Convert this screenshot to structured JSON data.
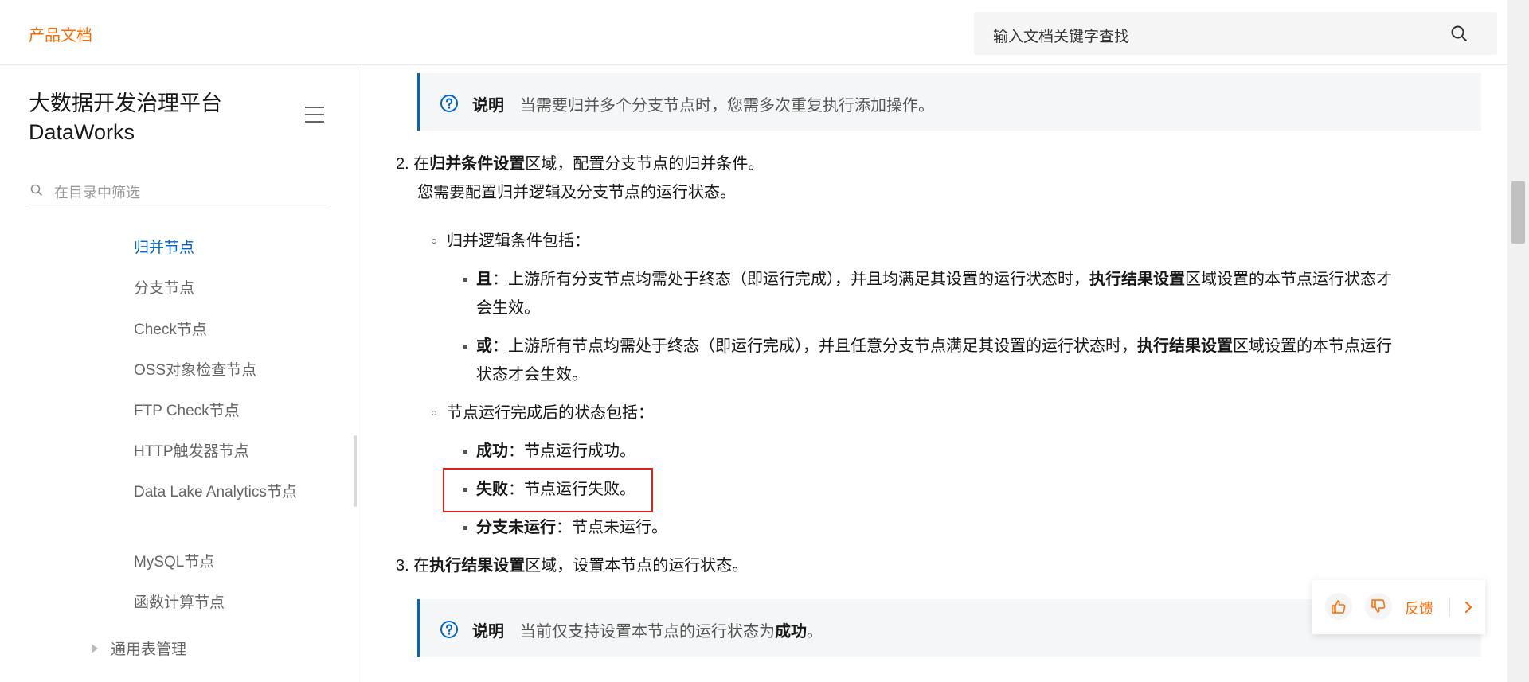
{
  "header": {
    "brand": "产品文档",
    "search_placeholder": "输入文档关键字查找"
  },
  "sidebar": {
    "title_line1": "大数据开发治理平台",
    "title_line2": "DataWorks",
    "filter_placeholder": "在目录中筛选",
    "items": [
      {
        "label": "归并节点",
        "active": true
      },
      {
        "label": "分支节点"
      },
      {
        "label": "Check节点"
      },
      {
        "label": "OSS对象检查节点"
      },
      {
        "label": "FTP Check节点"
      },
      {
        "label": "HTTP触发器节点"
      },
      {
        "label": "Data Lake Analytics节点"
      },
      {
        "label": "MySQL节点"
      },
      {
        "label": "函数计算节点"
      }
    ],
    "group": "通用表管理"
  },
  "content": {
    "note1": {
      "label": "说明",
      "text": "当需要归并多个分支节点时，您需多次重复执行添加操作。"
    },
    "step2": {
      "num": "2.",
      "pre": "在",
      "bold": "归并条件设置",
      "post": "区域，配置分支节点的归并条件。",
      "sub": "您需要配置归并逻辑及分支节点的运行状态。"
    },
    "logic_intro": "归并逻辑条件包括：",
    "and_item": {
      "bold": "且",
      "text1": "：上游所有分支节点均需处于终态（即运行完成），并且均满足其设置的运行状态时，",
      "bold2": "执行结果设置",
      "text2": "区域设置的本节点运行状态才",
      "text3": "会生效。"
    },
    "or_item": {
      "bold": "或",
      "text1": "：上游所有节点均需处于终态（即运行完成），并且任意分支节点满足其设置的运行状态时，",
      "bold2": "执行结果设置",
      "text2": "区域设置的本节点运行",
      "text3": "状态才会生效。"
    },
    "status_intro": "节点运行完成后的状态包括：",
    "status_success": {
      "bold": "成功",
      "text": "：节点运行成功。"
    },
    "status_fail": {
      "bold": "失败",
      "text": "：节点运行失败。"
    },
    "status_skip": {
      "bold": "分支未运行",
      "text": "：节点未运行。"
    },
    "step3": {
      "num": "3.",
      "pre": "在",
      "bold": "执行结果设置",
      "post": "区域，设置本节点的运行状态。"
    },
    "note2": {
      "label": "说明",
      "text": "当前仅支持设置本节点的运行状态为",
      "bold": "成功",
      "end": "。"
    }
  },
  "feedback": {
    "label": "反馈"
  },
  "colors": {
    "accent": "#ff6a00",
    "link": "#0064c8",
    "highlight": "#e02020"
  }
}
